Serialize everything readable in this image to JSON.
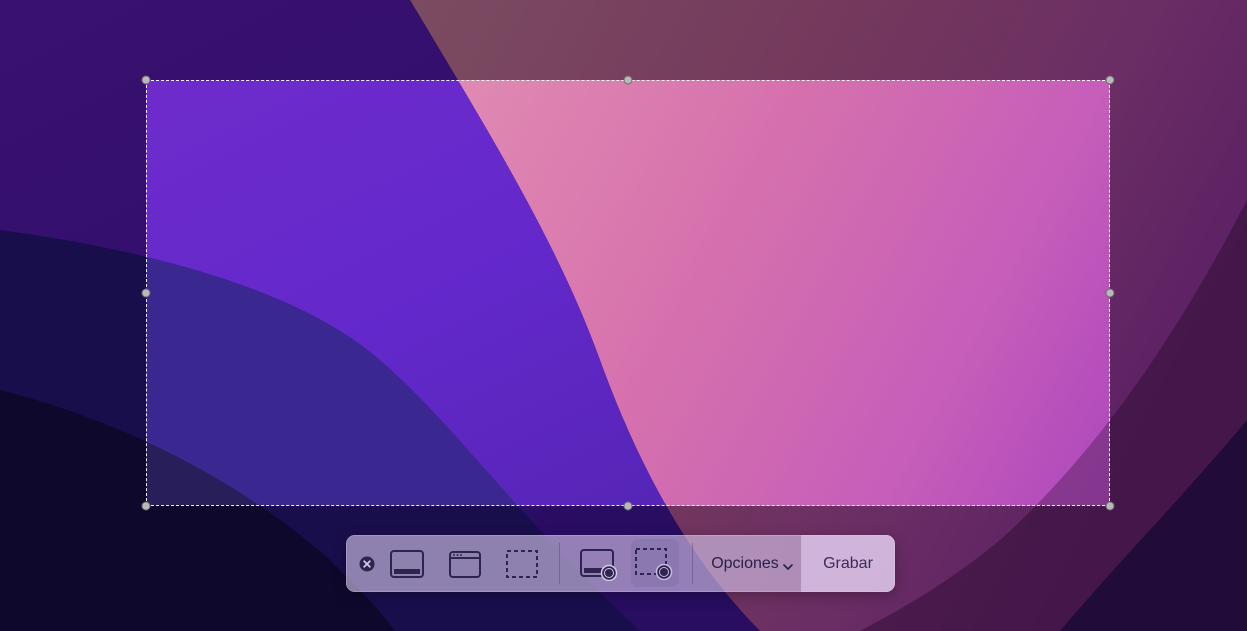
{
  "capture_toolbar": {
    "buttons": [
      {
        "name": "close",
        "icon": "close-circle-icon",
        "active": false
      },
      {
        "name": "capture-entire-screen",
        "icon": "entire-screen-icon",
        "active": false
      },
      {
        "name": "capture-selected-window",
        "icon": "window-icon",
        "active": false
      },
      {
        "name": "capture-selected-portion",
        "icon": "dashed-selection-icon",
        "active": false
      },
      {
        "name": "record-entire-screen",
        "icon": "record-screen-icon",
        "active": false
      },
      {
        "name": "record-selected-portion",
        "icon": "record-selection-icon",
        "active": true
      }
    ],
    "options_label": "Opciones",
    "record_label": "Grabar"
  },
  "colors": {
    "toolbar_bg": "#d6c8ec",
    "active_button_bg": "#826eaa",
    "selection_border": "#ffffff",
    "handle": "#b9b9b9"
  }
}
